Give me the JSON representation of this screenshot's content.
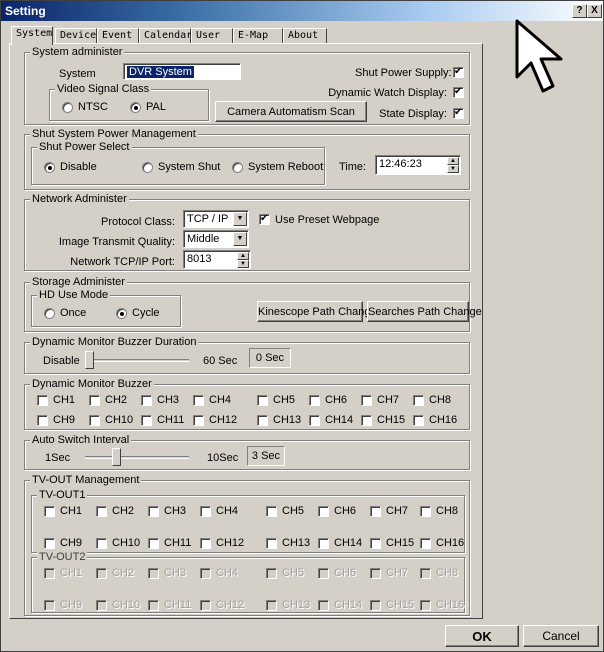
{
  "window": {
    "title": "Setting",
    "help_btn": "?",
    "close_btn": "X"
  },
  "tabs": [
    "System",
    "Device",
    "Event",
    "Calendar",
    "User",
    "E-Map",
    "About"
  ],
  "system_admin": {
    "group_label": "System administer",
    "system_label": "System",
    "system_value": "DVR System",
    "video_group_label": "Video Signal Class",
    "ntsc": "NTSC",
    "pal": "PAL",
    "video_selected": "PAL",
    "scan_button": "Camera Automatism Scan",
    "shut_power_supply": "Shut Power Supply:",
    "dynamic_watch_display": "Dynamic Watch Display:",
    "state_display": "State Display:",
    "shut_power_supply_checked": true,
    "dynamic_watch_display_checked": true,
    "state_display_checked": true
  },
  "shut_power": {
    "group_label": "Shut System Power Management",
    "select_label": "Shut Power Select",
    "disable": "Disable",
    "system_shut": "System Shut",
    "system_reboot": "System Reboot",
    "selected": "Disable",
    "time_label": "Time:",
    "time_value": "12:46:23"
  },
  "network": {
    "group_label": "Network Administer",
    "protocol_label": "Protocol Class:",
    "protocol_value": "TCP / IP",
    "preset_label": "Use Preset Webpage",
    "preset_checked": true,
    "quality_label": "Image Transmit Quality:",
    "quality_value": "Middle",
    "port_label": "Network TCP/IP Port:",
    "port_value": "8013"
  },
  "storage": {
    "group_label": "Storage Administer",
    "hd_group_label": "HD Use Mode",
    "once": "Once",
    "cycle": "Cycle",
    "selected": "Cycle",
    "kinescope_button": "Kinescope Path Change",
    "searches_button": "Searches Path Change"
  },
  "buzzer_duration": {
    "group_label": "Dynamic Monitor Buzzer Duration",
    "min_label": "Disable",
    "max_label": "60 Sec",
    "value": "0 Sec",
    "level": 0
  },
  "buzzer": {
    "group_label": "Dynamic Monitor Buzzer",
    "channels": [
      "CH1",
      "CH2",
      "CH3",
      "CH4",
      "CH5",
      "CH6",
      "CH7",
      "CH8",
      "CH9",
      "CH10",
      "CH11",
      "CH12",
      "CH13",
      "CH14",
      "CH15",
      "CH16"
    ]
  },
  "auto_switch": {
    "group_label": "Auto Switch Interval",
    "min_label": "1Sec",
    "max_label": "10Sec",
    "value": "3 Sec",
    "level": 3
  },
  "tvout": {
    "group_label": "TV-OUT Management",
    "out1_label": "TV-OUT1",
    "out2_label": "TV-OUT2",
    "channels": [
      "CH1",
      "CH2",
      "CH3",
      "CH4",
      "CH5",
      "CH6",
      "CH7",
      "CH8",
      "CH9",
      "CH10",
      "CH11",
      "CH12",
      "CH13",
      "CH14",
      "CH15",
      "CH16"
    ]
  },
  "footer": {
    "ok": "OK",
    "cancel": "Cancel"
  }
}
